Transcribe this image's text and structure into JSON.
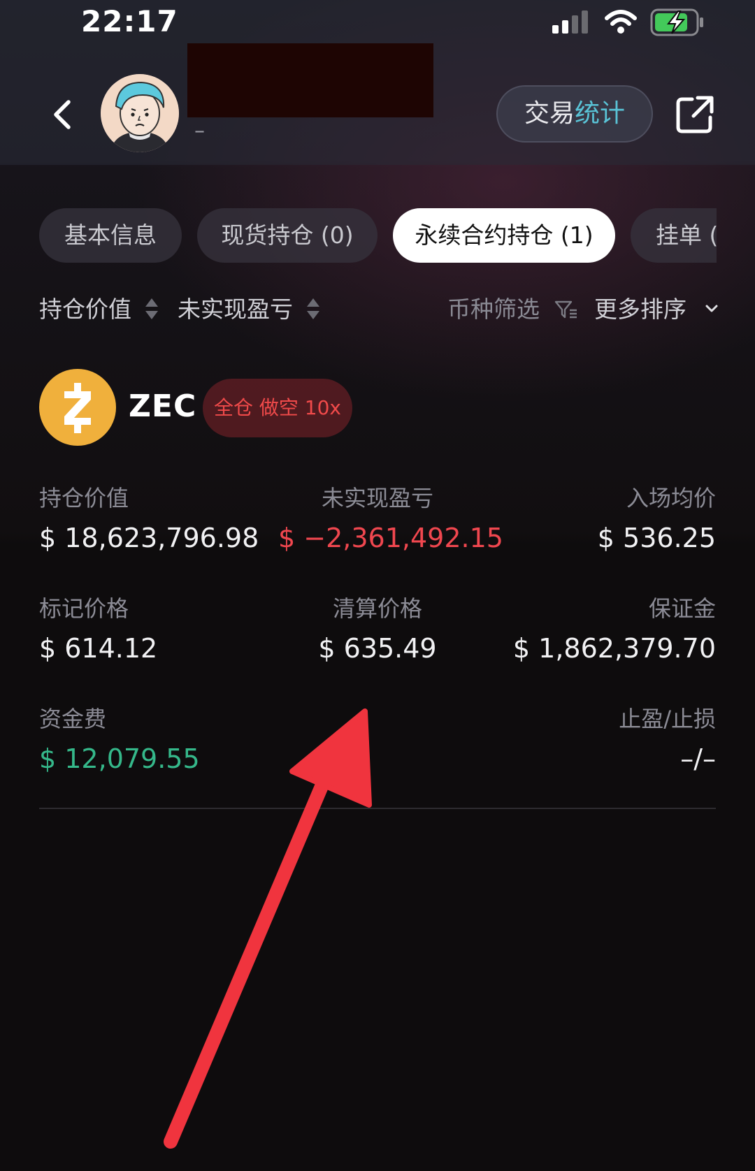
{
  "status_bar": {
    "time": "22:17"
  },
  "header": {
    "subtitle": "–",
    "stats_button": {
      "part1": "交易",
      "part2": "统计"
    }
  },
  "tabs": [
    {
      "label": "基本信息"
    },
    {
      "label": "现货持仓 (0)"
    },
    {
      "label": "永续合约持仓 (1)",
      "active": true
    },
    {
      "label": "挂单 ("
    }
  ],
  "sort_bar": {
    "position_value": "持仓价值",
    "unrealized_pnl": "未实现盈亏",
    "coin_filter": "币种筛选",
    "more_sort": "更多排序"
  },
  "position": {
    "coin": "ZEC",
    "coin_color": "#f0b03c",
    "badge": "全仓 做空 10x",
    "fields": {
      "position_value": {
        "label": "持仓价值",
        "value": "$ 18,623,796.98"
      },
      "unrealized_pnl": {
        "label": "未实现盈亏",
        "value": "$ −2,361,492.15"
      },
      "entry_price": {
        "label": "入场均价",
        "value": "$ 536.25"
      },
      "mark_price": {
        "label": "标记价格",
        "value": "$ 614.12"
      },
      "liquidation_price": {
        "label": "清算价格",
        "value": "$ 635.49"
      },
      "margin": {
        "label": "保证金",
        "value": "$ 1,862,379.70"
      },
      "funding_fee": {
        "label": "资金费",
        "value": "$ 12,079.55"
      },
      "tp_sl": {
        "label": "止盈/止损",
        "value": "–/–"
      }
    }
  },
  "colors": {
    "negative": "#f0474f",
    "positive": "#35b88a",
    "arrow": "#f0343e"
  }
}
